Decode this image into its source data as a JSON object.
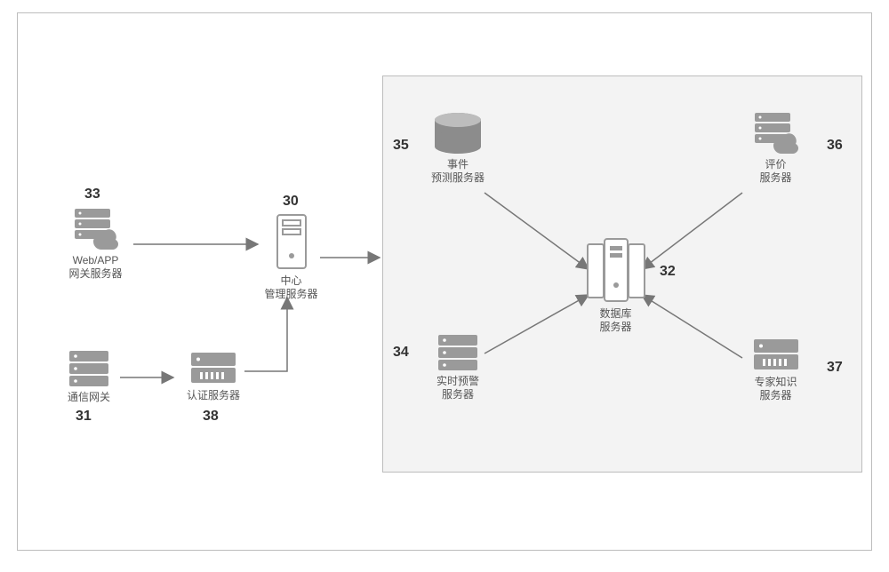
{
  "nodes": {
    "n33": {
      "num": "33",
      "label1": "Web/APP",
      "label2": "网关服务器"
    },
    "n31": {
      "num": "31",
      "label1": "通信网关"
    },
    "n38": {
      "num": "38",
      "label1": "认证服务器"
    },
    "n30": {
      "num": "30",
      "label1": "中心",
      "label2": "管理服务器"
    },
    "n35": {
      "num": "35",
      "label1": "事件",
      "label2": "预测服务器"
    },
    "n34": {
      "num": "34",
      "label1": "实时预警",
      "label2": "服务器"
    },
    "n32": {
      "num": "32",
      "label1": "数据库",
      "label2": "服务器"
    },
    "n36": {
      "num": "36",
      "label1": "评价",
      "label2": "服务器"
    },
    "n37": {
      "num": "37",
      "label1": "专家知识",
      "label2": "服务器"
    }
  }
}
